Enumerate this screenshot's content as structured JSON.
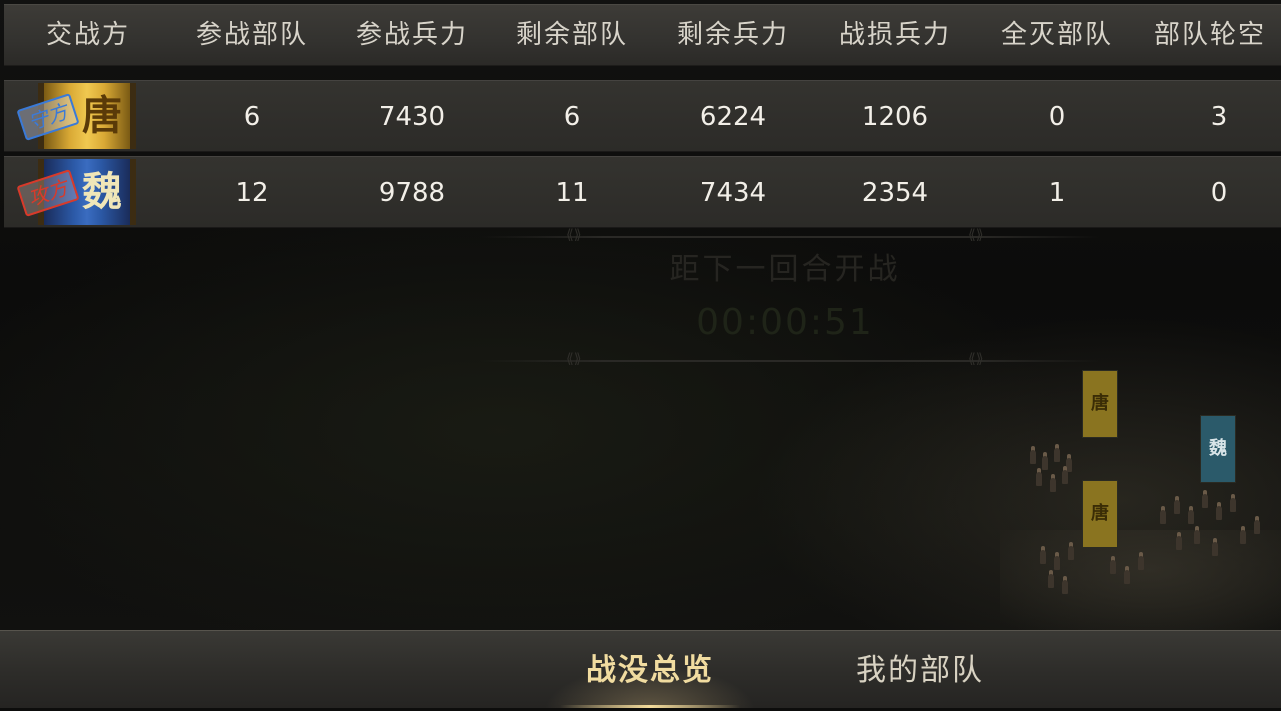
{
  "header": {
    "columns": [
      "交战方",
      "参战部队",
      "参战兵力",
      "剩余部队",
      "剩余兵力",
      "战损兵力",
      "全灭部队",
      "部队轮空"
    ]
  },
  "rows": [
    {
      "side_stamp": "守方",
      "faction_char": "唐",
      "faction_color": "#d9a935",
      "values": [
        "6",
        "7430",
        "6",
        "6224",
        "1206",
        "0",
        "3"
      ]
    },
    {
      "side_stamp": "攻方",
      "faction_char": "魏",
      "faction_color": "#2c5aa8",
      "values": [
        "12",
        "9788",
        "11",
        "7434",
        "2354",
        "1",
        "0"
      ]
    }
  ],
  "countdown": {
    "label": "距下一回合开战",
    "time": "00:00:51"
  },
  "army_flags": [
    "唐",
    "唐",
    "魏"
  ],
  "tabs": {
    "overview": "战没总览",
    "my_troops": "我的部队"
  }
}
